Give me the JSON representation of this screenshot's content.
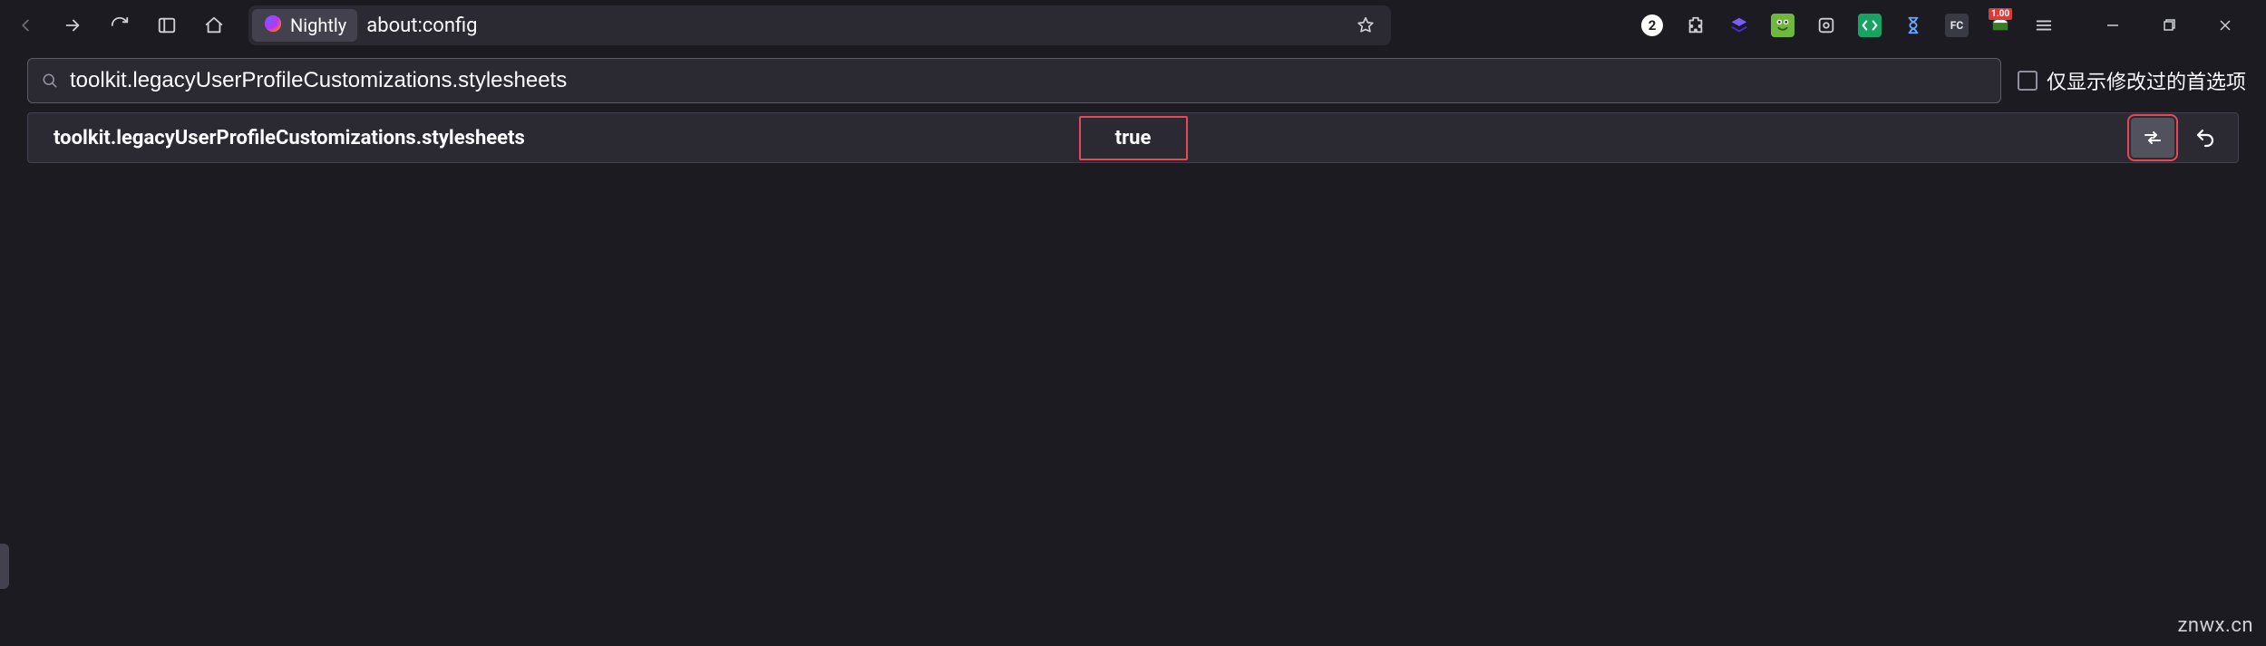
{
  "toolbar": {
    "identity_label": "Nightly",
    "url": "about:config"
  },
  "extensions": {
    "badge_count": "2",
    "flag_badge": "1.00"
  },
  "filter": {
    "search_value": "toolkit.legacyUserProfileCustomizations.stylesheets",
    "modified_only_label": "仅显示修改过的首选项",
    "modified_only_checked": false
  },
  "results": [
    {
      "name": "toolkit.legacyUserProfileCustomizations.stylesheets",
      "value": "true"
    }
  ],
  "watermark": "znwx.cn"
}
